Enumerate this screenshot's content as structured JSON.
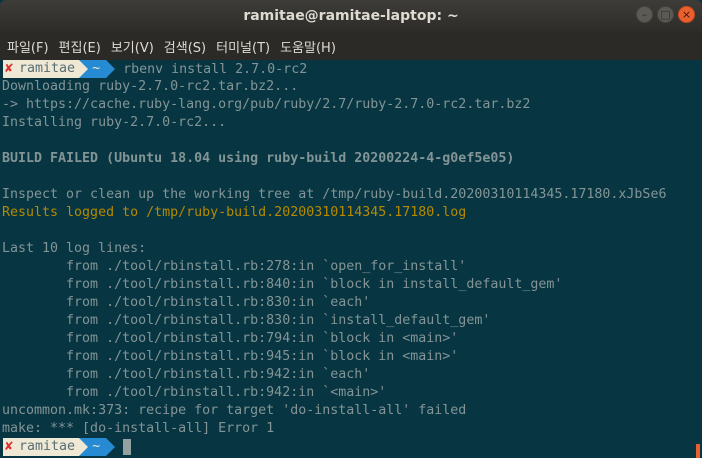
{
  "window": {
    "title": "ramitae@ramitae-laptop: ~",
    "controls": {
      "minimize": "–",
      "maximize": "□",
      "close": "×"
    }
  },
  "menu": [
    "파일(F)",
    "편집(E)",
    "보기(V)",
    "검색(S)",
    "터미널(T)",
    "도움말(H)"
  ],
  "prompt": {
    "status_icon": "x-mark-icon",
    "status_glyph": "✘",
    "user": "ramitae",
    "dir": "~"
  },
  "command": "rbenv install 2.7.0-rc2",
  "output": [
    "Downloading ruby-2.7.0-rc2.tar.bz2...",
    "-> https://cache.ruby-lang.org/pub/ruby/2.7/ruby-2.7.0-rc2.tar.bz2",
    "Installing ruby-2.7.0-rc2...",
    "",
    "BUILD FAILED (Ubuntu 18.04 using ruby-build 20200224-4-g0ef5e05)",
    "",
    "Inspect or clean up the working tree at /tmp/ruby-build.20200310114345.17180.xJbSe6",
    "Results logged to /tmp/ruby-build.20200310114345.17180.log",
    "",
    "Last 10 log lines:",
    "        from ./tool/rbinstall.rb:278:in `open_for_install'",
    "        from ./tool/rbinstall.rb:840:in `block in install_default_gem'",
    "        from ./tool/rbinstall.rb:830:in `each'",
    "        from ./tool/rbinstall.rb:830:in `install_default_gem'",
    "        from ./tool/rbinstall.rb:794:in `block in <main>'",
    "        from ./tool/rbinstall.rb:945:in `block in <main>'",
    "        from ./tool/rbinstall.rb:942:in `each'",
    "        from ./tool/rbinstall.rb:942:in `<main>'",
    "uncommon.mk:373: recipe for target 'do-install-all' failed",
    "make: *** [do-install-all] Error 1"
  ],
  "colors": {
    "background": "#073642",
    "text": "#839496",
    "yellow": "#b58900",
    "prompt_user_bg": "#eee8d5",
    "prompt_dir_bg": "#268bd2",
    "error_red": "#dc322f"
  }
}
